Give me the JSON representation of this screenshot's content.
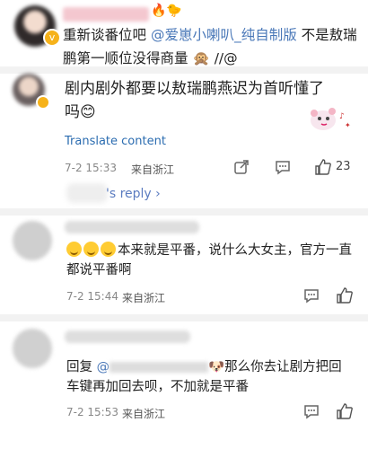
{
  "top_comment": {
    "text_main": "重新谈番位吧",
    "mention": "@爱崽小喇叭_纯自制版",
    "text_tail": "不是敖瑞鹏第一顺位没得商量",
    "suffix": "//@"
  },
  "comment_1": {
    "text": "剧内剧外都要以敖瑞鹏燕迟为首听懂了吗",
    "emoji": "😊",
    "translate_label": "Translate content",
    "date": "7-2 15:33",
    "location": "来自浙江",
    "like_count": "23",
    "reply_label": "'s reply ›"
  },
  "comment_2": {
    "text": "本来就是平番，说什么大女主，官方一直都说平番啊",
    "date": "7-2 15:44",
    "location": "来自浙江"
  },
  "comment_3": {
    "reply_prefix": "回复",
    "mention": "@",
    "text": "那么你去让剧方把回车键再加回去呗，不加就是平番",
    "date": "7-2 15:53",
    "location": "来自浙江"
  },
  "icons": {
    "share": "share-icon",
    "comment": "comment-icon",
    "like": "thumbs-up-icon"
  },
  "colors": {
    "link": "#4a78b8",
    "translate": "#2b6cb0",
    "divider": "#f2f2f2"
  }
}
